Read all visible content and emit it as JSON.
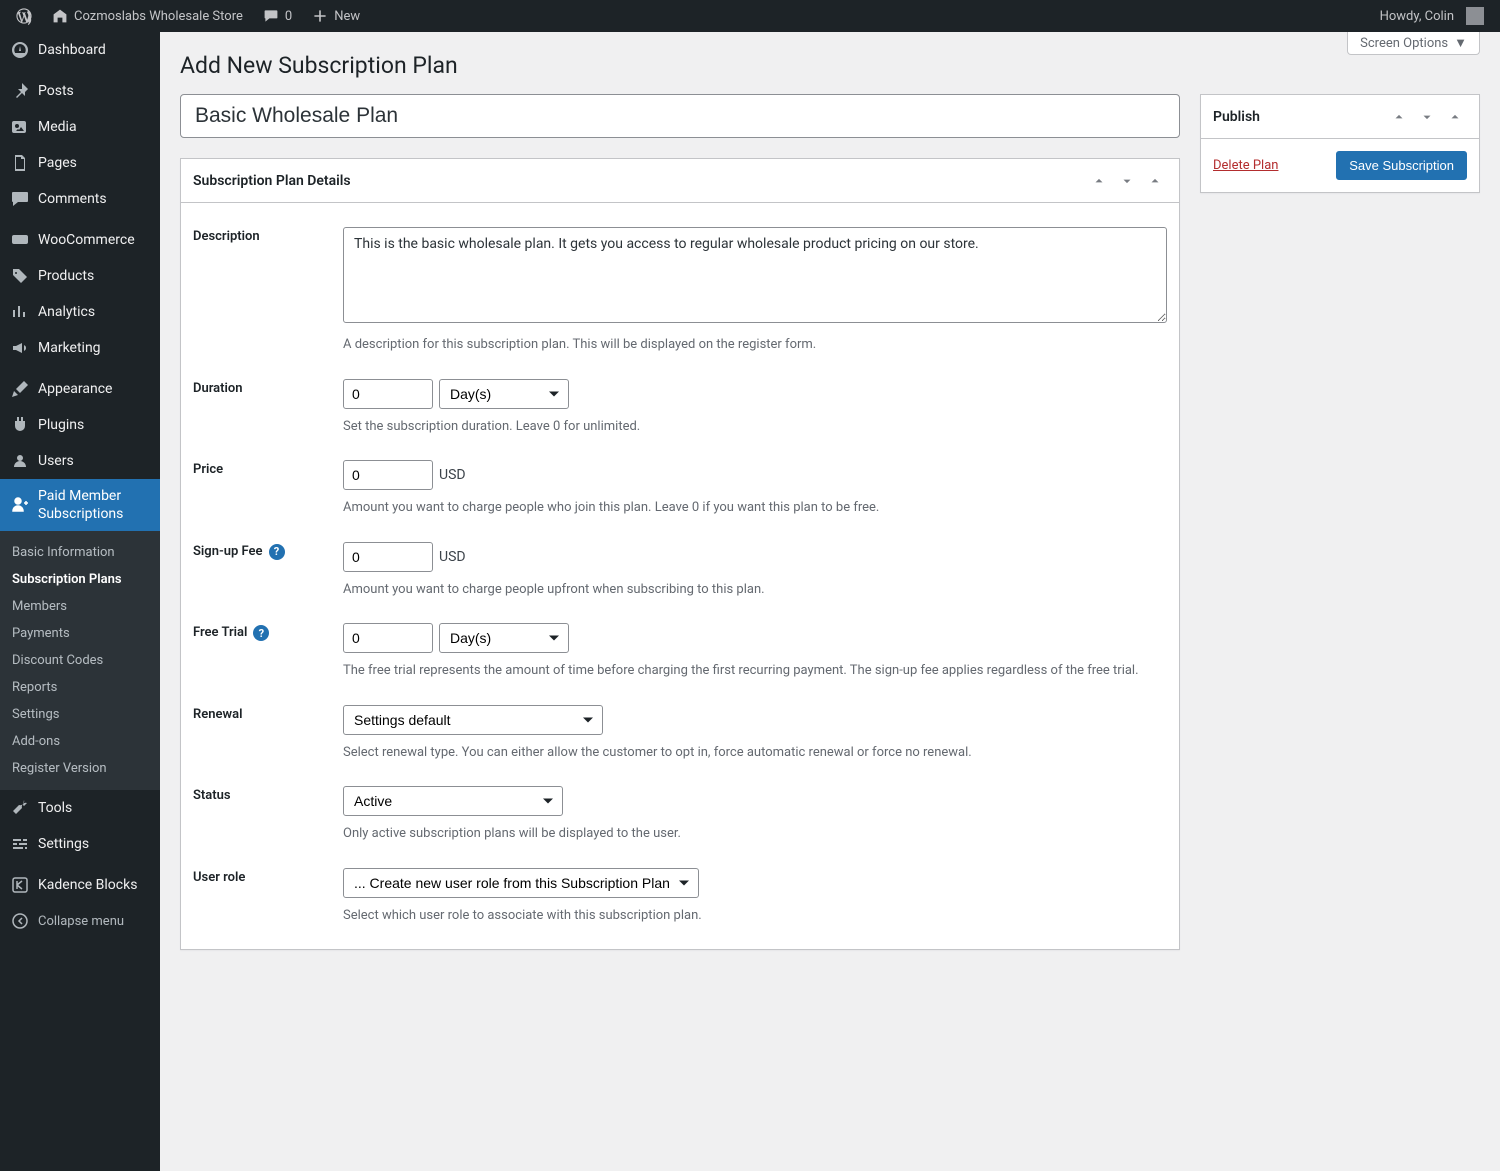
{
  "adminbar": {
    "site_name": "Cozmoslabs Wholesale Store",
    "comments_count": "0",
    "new_label": "New",
    "greeting": "Howdy, Colin"
  },
  "screen_options_label": "Screen Options",
  "page_title": "Add New Subscription Plan",
  "title_value": "Basic Wholesale Plan",
  "sidebar": {
    "dashboard": "Dashboard",
    "posts": "Posts",
    "media": "Media",
    "pages": "Pages",
    "comments": "Comments",
    "woocommerce": "WooCommerce",
    "products": "Products",
    "analytics": "Analytics",
    "marketing": "Marketing",
    "appearance": "Appearance",
    "plugins": "Plugins",
    "users": "Users",
    "pms": "Paid Member Subscriptions",
    "tools": "Tools",
    "settings": "Settings",
    "kadence": "Kadence Blocks",
    "collapse": "Collapse menu",
    "sub": {
      "basic": "Basic Information",
      "plans": "Subscription Plans",
      "members": "Members",
      "payments": "Payments",
      "discounts": "Discount Codes",
      "reports": "Reports",
      "settings": "Settings",
      "addons": "Add-ons",
      "register": "Register Version"
    }
  },
  "details": {
    "box_title": "Subscription Plan Details",
    "description_label": "Description",
    "description_value": "This is the basic wholesale plan. It gets you access to regular wholesale product pricing on our store.",
    "description_help": "A description for this subscription plan. This will be displayed on the register form.",
    "duration_label": "Duration",
    "duration_value": "0",
    "duration_unit": "Day(s)",
    "duration_help": "Set the subscription duration. Leave 0 for unlimited.",
    "price_label": "Price",
    "price_value": "0",
    "price_currency": "USD",
    "price_help": "Amount you want to charge people who join this plan. Leave 0 if you want this plan to be free.",
    "signup_label": "Sign-up Fee",
    "signup_value": "0",
    "signup_currency": "USD",
    "signup_help": "Amount you want to charge people upfront when subscribing to this plan.",
    "trial_label": "Free Trial",
    "trial_value": "0",
    "trial_unit": "Day(s)",
    "trial_help": "The free trial represents the amount of time before charging the first recurring payment. The sign-up fee applies regardless of the free trial.",
    "renewal_label": "Renewal",
    "renewal_value": "Settings default",
    "renewal_help": "Select renewal type. You can either allow the customer to opt in, force automatic renewal or force no renewal.",
    "status_label": "Status",
    "status_value": "Active",
    "status_help": "Only active subscription plans will be displayed to the user.",
    "role_label": "User role",
    "role_value": "... Create new user role from this Subscription Plan",
    "role_help": "Select which user role to associate with this subscription plan."
  },
  "publish": {
    "box_title": "Publish",
    "delete_label": "Delete Plan",
    "save_label": "Save Subscription"
  }
}
